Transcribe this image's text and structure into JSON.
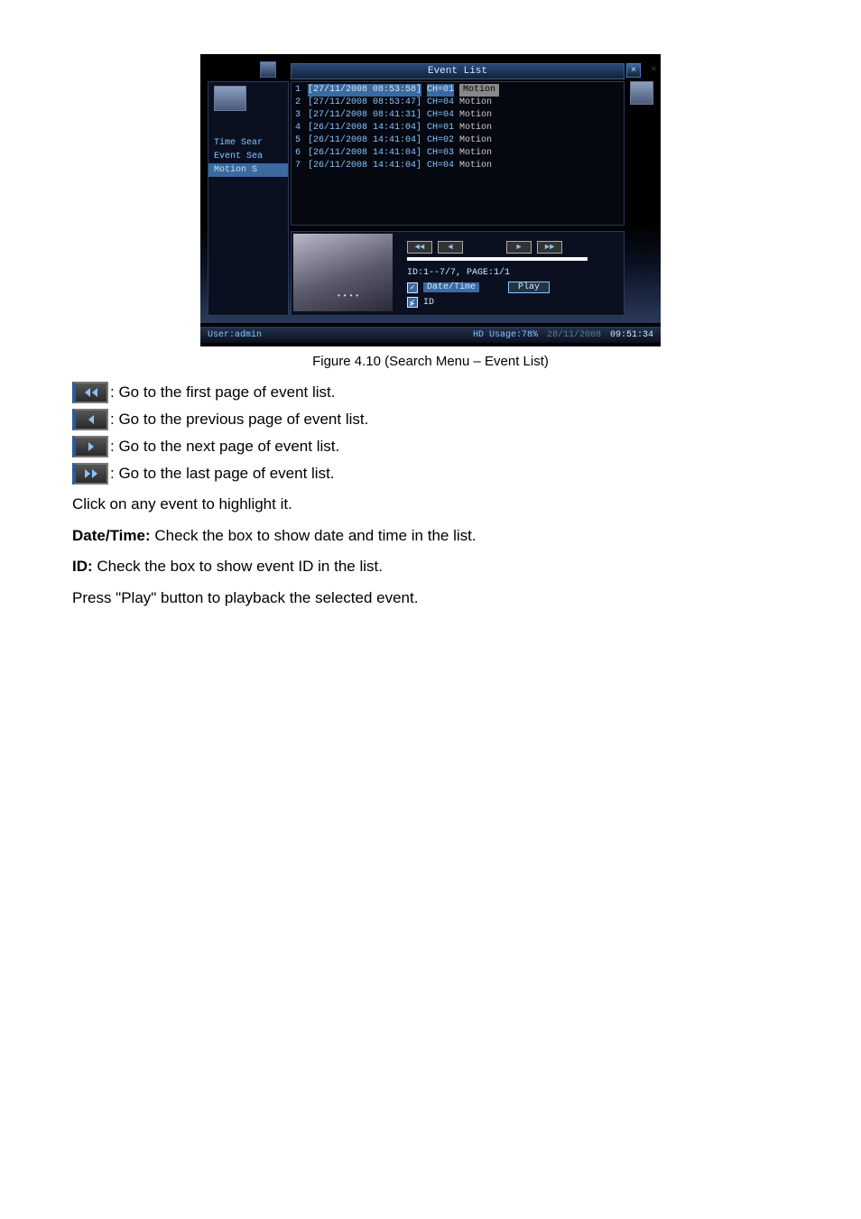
{
  "screenshot": {
    "titlebar": "Event List",
    "close_label": "×",
    "faded_x": "×",
    "sidebar": {
      "items": [
        "Time Sear",
        "Event Sea",
        "Motion S"
      ]
    },
    "events": [
      {
        "n": "1",
        "dt": "[27/11/2008 08:53:58]",
        "ch": "CH=01",
        "type": "Motion"
      },
      {
        "n": "2",
        "dt": "[27/11/2008 08:53:47]",
        "ch": "CH=04",
        "type": "Motion"
      },
      {
        "n": "3",
        "dt": "[27/11/2008 08:41:31]",
        "ch": "CH=04",
        "type": "Motion"
      },
      {
        "n": "4",
        "dt": "[26/11/2008 14:41:04]",
        "ch": "CH=01",
        "type": "Motion"
      },
      {
        "n": "5",
        "dt": "[26/11/2008 14:41:04]",
        "ch": "CH=02",
        "type": "Motion"
      },
      {
        "n": "6",
        "dt": "[26/11/2008 14:41:04]",
        "ch": "CH=03",
        "type": "Motion"
      },
      {
        "n": "7",
        "dt": "[26/11/2008 14:41:04]",
        "ch": "CH=04",
        "type": "Motion"
      }
    ],
    "nav": {
      "first": "◄◄",
      "prev": "◄",
      "next": "►",
      "last": "►►"
    },
    "idpage": "ID:1--7/7, PAGE:1/1",
    "datetime_label": "Date/Time",
    "id_label": "ID",
    "play_label": "Play",
    "check_glyph": "✓",
    "status": {
      "user": "User:admin",
      "hd": "HD Usage:78%",
      "date": "28/11/2008",
      "time": "09:51:34"
    }
  },
  "caption": "Figure 4.10 (Search Menu – Event List)",
  "btn_desc": {
    "first": ": Go to the first page of event list.",
    "prev": ": Go to the previous page of event list.",
    "next": ": Go to the next page of event list.",
    "last": ": Go to the last page of event list."
  },
  "paras": {
    "highlight": "Click on any event to highlight it.",
    "datetime_label": "Date/Time:",
    "datetime_text": " Check the box to show date and time in the list.",
    "id_label": "ID:",
    "id_text": " Check the box to show event ID in the list.",
    "play": "Press \"Play\" button to playback the selected event."
  }
}
